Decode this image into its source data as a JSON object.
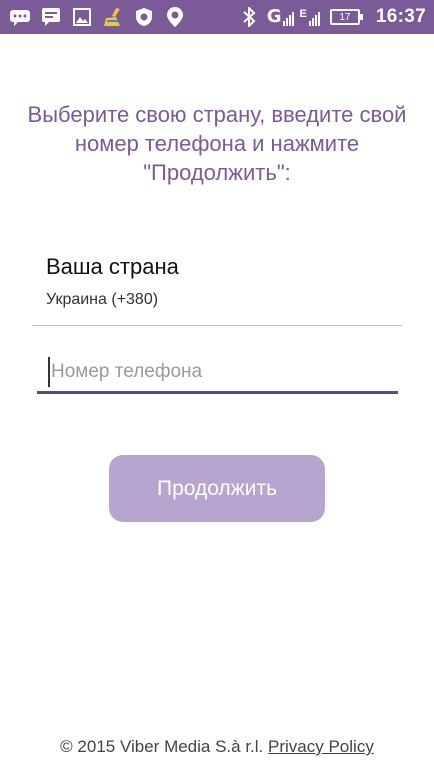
{
  "status_bar": {
    "network_1": "G",
    "network_2": "E",
    "battery": "17",
    "time": "16:37",
    "icons": [
      "message-bubbles-icon",
      "chat-icon",
      "gallery-icon",
      "broom-cleaner-icon",
      "shield-icon",
      "location-pin-icon",
      "bluetooth-icon"
    ]
  },
  "instructions": "Выберите свою страну, введите свой номер телефона и нажмите \"Продолжить\":",
  "country": {
    "label": "Ваша страна",
    "value": "Украина (+380)"
  },
  "phone": {
    "placeholder": "Номер телефона",
    "value": ""
  },
  "continue_button": "Продолжить",
  "footer": {
    "copyright": "© 2015 Viber Media S.à r.l.",
    "privacy_link": "Privacy Policy"
  },
  "colors": {
    "accent": "#7a5b98",
    "button_disabled": "#b5a5cf",
    "input_underline": "#5b4783"
  }
}
